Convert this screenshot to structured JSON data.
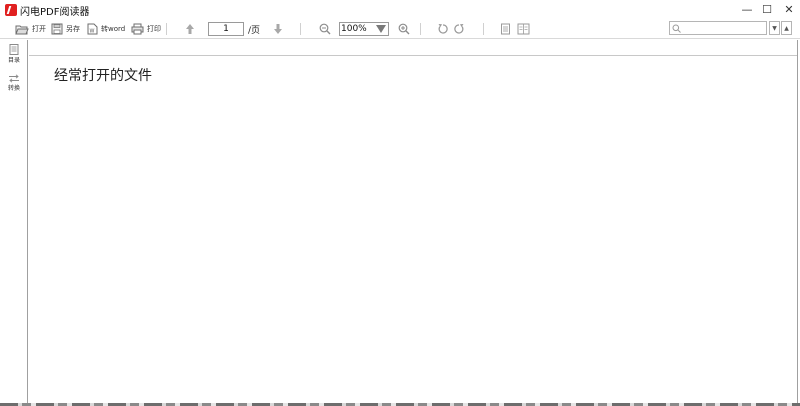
{
  "window": {
    "title": "闪电PDF阅读器",
    "minimize": "—",
    "maximize": "☐",
    "close": "✕"
  },
  "toolbar": {
    "open_label": "打开",
    "save_as_label": "另存",
    "to_word_label": "转word",
    "print_label": "打印",
    "page_current": "1",
    "page_suffix": "/页",
    "zoom_value": "100%"
  },
  "search": {
    "placeholder": "",
    "prev": "▼",
    "next": "▲"
  },
  "sidebar": {
    "items": [
      {
        "label": "目录",
        "icon": "outline-icon"
      },
      {
        "label": "转换",
        "icon": "convert-icon"
      }
    ]
  },
  "main": {
    "recent_title": "经常打开的文件"
  },
  "colors": {
    "brand": "#e02020",
    "border": "#a0a0a0"
  }
}
